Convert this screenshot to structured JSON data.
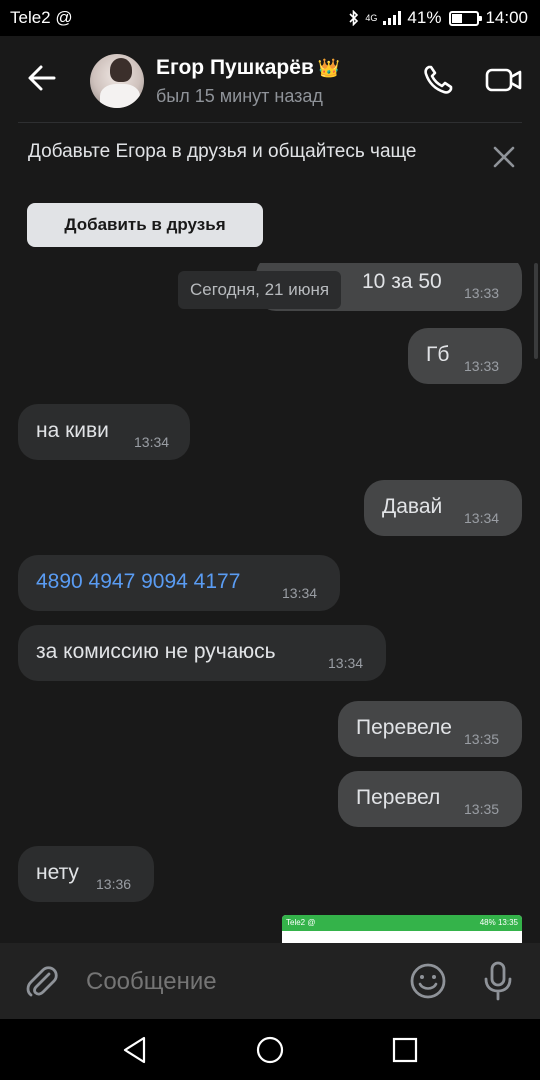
{
  "status_bar": {
    "carrier": "Tele2 @",
    "network": "4G",
    "battery": "41%",
    "battery_level": 0.41,
    "time": "14:00"
  },
  "header": {
    "contact_name": "Егор Пушкарёв",
    "badge_emoji": "👑",
    "last_seen": "был 15 минут назад",
    "icons": [
      "back-arrow-icon",
      "phone-icon",
      "video-camera-icon"
    ]
  },
  "banner": {
    "text": "Добавьте Егора в друзья и общайтесь чаще",
    "button_label": "Добавить в друзья",
    "close_icon": "close-icon"
  },
  "chat": {
    "date_separator": "Сегодня, 21 июня",
    "messages": [
      {
        "direction": "out",
        "text": "10 за 50",
        "time": "13:33"
      },
      {
        "direction": "out",
        "text": "Гб",
        "time": "13:33"
      },
      {
        "direction": "in",
        "text": "на киви",
        "time": "13:34"
      },
      {
        "direction": "out",
        "text": "Давай",
        "time": "13:34"
      },
      {
        "direction": "in",
        "text": "4890 4947 9094 4177",
        "time": "13:34",
        "is_link": true
      },
      {
        "direction": "in",
        "text": "за комиссию не ручаюсь",
        "time": "13:34"
      },
      {
        "direction": "out",
        "text": "Перевеле",
        "time": "13:35"
      },
      {
        "direction": "out",
        "text": "Перевел",
        "time": "13:35"
      },
      {
        "direction": "in",
        "text": "нету",
        "time": "13:36"
      }
    ],
    "image_preview": {
      "strip_left": "Tele2 @",
      "strip_right": "48% 13:35"
    }
  },
  "composer": {
    "placeholder": "Сообщение",
    "icons": [
      "paperclip-icon",
      "emoji-icon",
      "microphone-icon"
    ]
  },
  "nav": {
    "icons": [
      "back-triangle-icon",
      "home-circle-icon",
      "recents-square-icon"
    ]
  },
  "colors": {
    "background": "#191919",
    "incoming_bubble": "#2c2d2e",
    "outgoing_bubble": "#454647",
    "link": "#5a9cf3",
    "crown": "#f2b83b"
  }
}
